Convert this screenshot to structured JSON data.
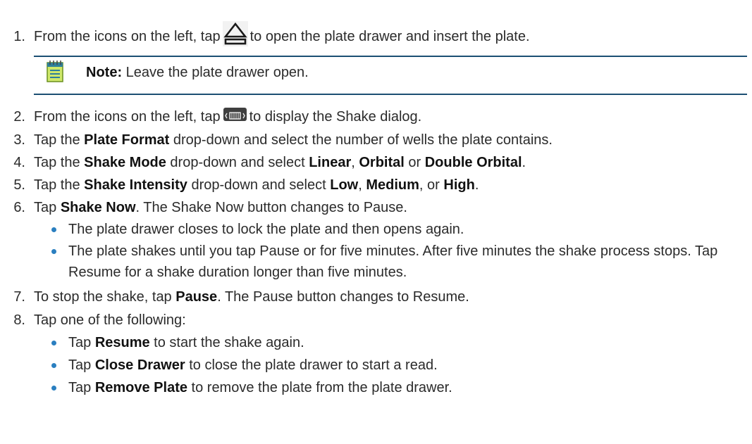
{
  "steps": [
    {
      "num": "1.",
      "pre": "From the icons on the left, tap",
      "post": "to open the plate drawer and insert the plate."
    },
    {
      "num": "2.",
      "pre": "From the icons on the left, tap",
      "post": "to display the Shake dialog."
    },
    {
      "num": "3.",
      "a": "Tap the ",
      "b1": "Plate Format",
      "c": " drop-down and select the number of wells the plate contains."
    },
    {
      "num": "4.",
      "a": "Tap the ",
      "b1": "Shake Mode",
      "c": " drop-down and select ",
      "b2": "Linear",
      "d": ", ",
      "b3": "Orbital",
      "e": " or ",
      "b4": "Double Orbital",
      "f": "."
    },
    {
      "num": "5.",
      "a": "Tap the ",
      "b1": "Shake Intensity",
      "c": " drop-down and select ",
      "b2": "Low",
      "d": ", ",
      "b3": "Medium",
      "e": ", or ",
      "b4": "High",
      "f": "."
    },
    {
      "num": "6.",
      "a": "Tap ",
      "b1": "Shake Now",
      "c": ". The Shake Now button changes to Pause."
    },
    {
      "num": "7.",
      "a": "To stop the shake, tap ",
      "b1": "Pause",
      "c": ". The Pause button changes to Resume."
    },
    {
      "num": "8.",
      "a": "Tap one of the following:"
    }
  ],
  "note": {
    "label": "Note:",
    "text": " Leave the plate drawer open."
  },
  "step6_bullets": [
    "The plate drawer closes to lock the plate and then opens again.",
    "The plate shakes until you tap Pause or for five minutes. After five minutes the shake process stops. Tap Resume for a shake duration longer than five minutes."
  ],
  "step8_bullets": [
    {
      "a": "Tap ",
      "b": "Resume",
      "c": " to start the shake again."
    },
    {
      "a": "Tap ",
      "b": "Close Drawer",
      "c": " to close the plate drawer to start a read."
    },
    {
      "a": "Tap ",
      "b": "Remove Plate",
      "c": " to remove the plate from the plate drawer."
    }
  ],
  "icons": {
    "step1": "eject-icon",
    "step2": "shake-icon",
    "note": "note-icon"
  },
  "colors": {
    "rule": "#1c4f73",
    "bullet": "#2a7fc0",
    "text": "#2b2b2b"
  }
}
